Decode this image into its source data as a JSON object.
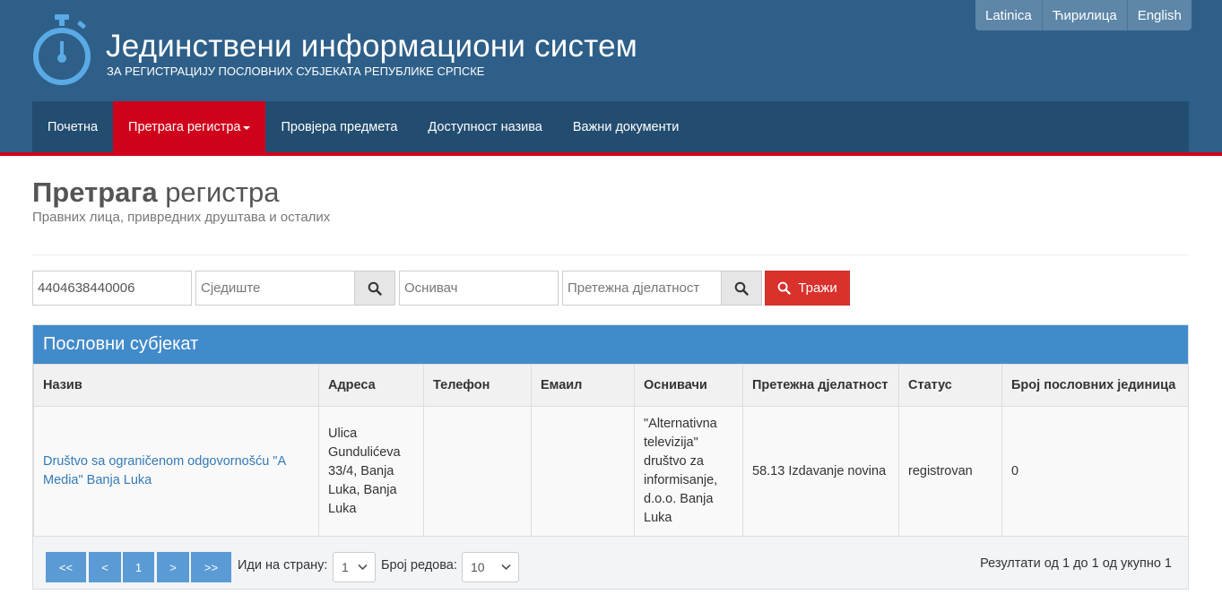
{
  "header": {
    "title": "Јединствени информациони систем",
    "subtitle": "ЗА РЕГИСТРАЦИЈУ ПОСЛОВНИХ СУБЈЕКАТА РЕПУБЛИКЕ СРПСКЕ",
    "languages": [
      "Latinica",
      "Ћирилица",
      "English"
    ]
  },
  "nav": {
    "items": [
      "Почетна",
      "Претрага регистра",
      "Провјера предмета",
      "Доступност назива",
      "Важни документи"
    ],
    "active_index": 1
  },
  "page": {
    "title_bold": "Претрага",
    "title_light": "регистра",
    "subtitle": "Правних лица, привредних друштава и осталих"
  },
  "search": {
    "id_value": "4404638440006",
    "seat_placeholder": "Сједиште",
    "founder_placeholder": "Оснивач",
    "activity_placeholder": "Претежна дјелатност",
    "submit_label": "Тражи"
  },
  "panel": {
    "heading": "Пословни субјекат",
    "columns": [
      "Назив",
      "Адреса",
      "Телефон",
      "Емаил",
      "Оснивачи",
      "Претежна дјелатност",
      "Статус",
      "Број пословних јединица"
    ],
    "rows": [
      {
        "name": "Društvo sa ograničenom odgovornošću \"A Media\" Banja Luka",
        "address": "Ulica Gundulićeva 33/4, Banja Luka, Banja Luka",
        "phone": "",
        "email": "",
        "founders": "\"Alternativna televizija\" društvo za informisanje, d.o.o. Banja Luka",
        "activity": "58.13 Izdavanje novina",
        "status": "registrovan",
        "units": "0"
      }
    ]
  },
  "pagination": {
    "first": "<<",
    "prev": "<",
    "current": "1",
    "next": ">",
    "last": ">>",
    "goto_label": "Иди на страну:",
    "goto_value": "1",
    "rows_label": "Број редова:",
    "rows_value": "10",
    "results_text": "Резултати од 1 до 1 од укупно 1"
  },
  "colors": {
    "header_bg": "#2e5f88",
    "nav_bg": "#234d70",
    "accent_red": "#d0021b",
    "panel_blue": "#428bca",
    "link": "#337ab7"
  }
}
